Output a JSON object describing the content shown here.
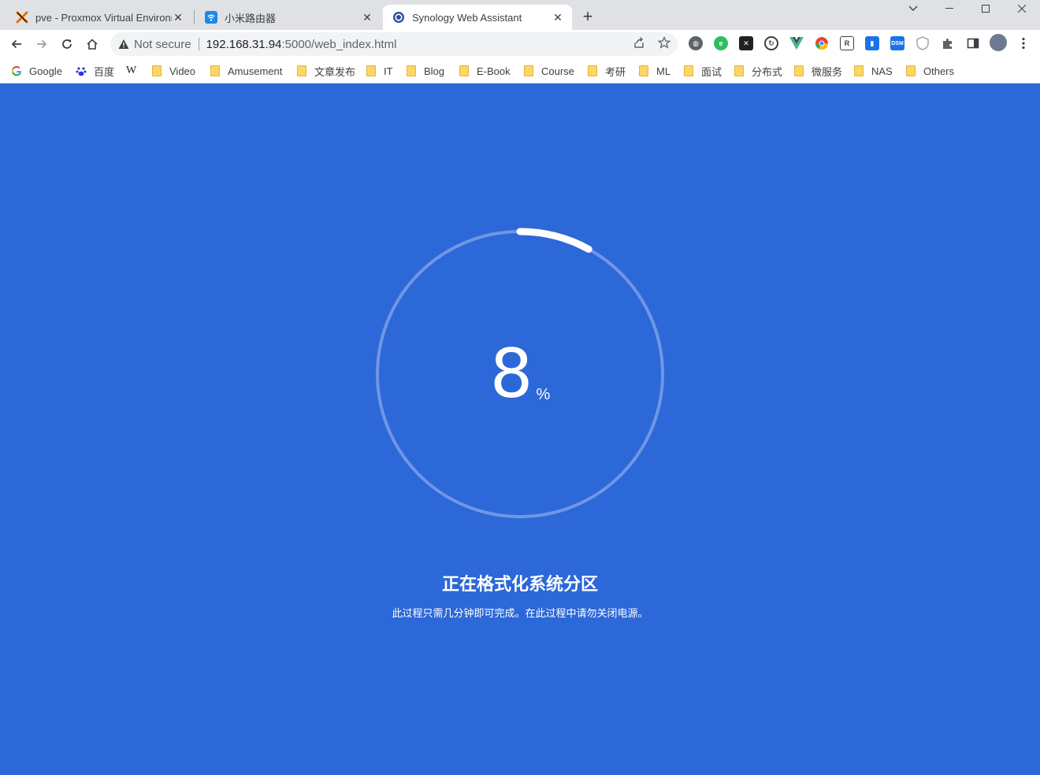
{
  "browser": {
    "tabs": [
      {
        "title": "pve - Proxmox Virtual Environment",
        "active": false,
        "favicon": "proxmox-icon"
      },
      {
        "title": "小米路由器",
        "active": false,
        "favicon": "wifi-icon"
      },
      {
        "title": "Synology Web Assistant",
        "active": true,
        "favicon": "synology-icon"
      }
    ],
    "address": {
      "security": "Not secure",
      "host": "192.168.31.94",
      "path": ":5000/web_index.html"
    },
    "bookmarks": [
      "Google",
      "百度",
      "W",
      "Video",
      "Amusement",
      "文章发布",
      "IT",
      "Blog",
      "E-Book",
      "Course",
      "考研",
      "ML",
      "面试",
      "分布式",
      "微服务",
      "NAS",
      "Others"
    ],
    "extensions": [
      "globe-extension-icon",
      "evernote-extension-icon",
      "x-extension-icon",
      "sync-extension-icon",
      "vue-devtools-icon",
      "chrome-color-icon",
      "clipboard-extension-icon",
      "blue-bookmark-icon",
      "dsm-extension-icon",
      "shield-extension-icon",
      "puzzle-extensions-icon",
      "side-panel-icon",
      "profile-avatar"
    ]
  },
  "progress": {
    "percent": "8",
    "percent_sign": "%",
    "fraction": 0.08,
    "title": "正在格式化系统分区",
    "subtitle": "此过程只需几分钟即可完成。在此过程中请勿关闭电源。"
  },
  "colors": {
    "background": "#2c68d8",
    "ring_track": "#6f97e4",
    "ring_progress": "#ffffff"
  }
}
